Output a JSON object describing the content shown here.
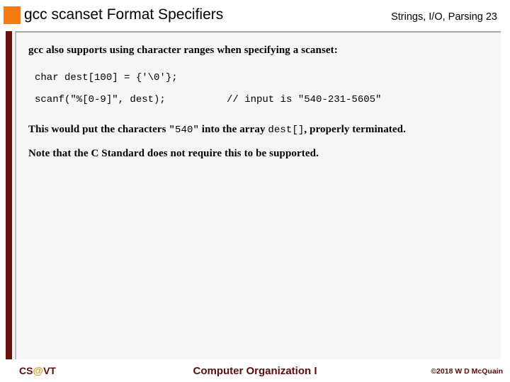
{
  "header": {
    "title": "gcc scanset Format Specifiers",
    "right_label": "Strings, I/O, Parsing 23",
    "accent_color": "#F47B16"
  },
  "sidebar": {
    "bar_color": "#6B0F0F"
  },
  "content": {
    "panel_bg": "#F6F6F6",
    "intro": "gcc also supports using character ranges when specifying a scanset:",
    "code_line_1": "char dest[100] = {'\\0'};",
    "code_line_2": "scanf(\"%[0-9]\", dest);",
    "code_comment": "// input is \"540-231-5605\"",
    "result_prefix": "This would put the characters ",
    "result_mono_1": "\"540\"",
    "result_middle": " into the array ",
    "result_mono_2": "dest[]",
    "result_suffix": ", properly terminated.",
    "note": "Note that the C Standard does not require this to be supported."
  },
  "footer": {
    "logo_prefix": "CS",
    "logo_at": "@",
    "logo_suffix": "VT",
    "center": "Computer Organization I",
    "copyright": "©2018 W D McQuain",
    "text_color": "#5C0A0A",
    "at_color": "#D99A2B"
  }
}
